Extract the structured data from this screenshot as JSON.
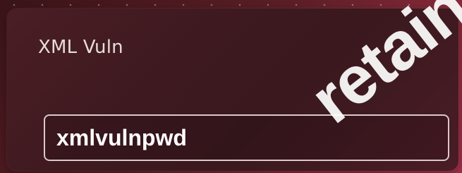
{
  "dialog": {
    "title": "XML Vuln",
    "field_value": "xmlvulnpwd"
  },
  "watermark": {
    "text": "retains"
  },
  "colors": {
    "background_accent": "#8a2a3a",
    "dialog_bg": "#3e1a20",
    "field_border": "#d9c9cb",
    "text": "#ffffff"
  }
}
